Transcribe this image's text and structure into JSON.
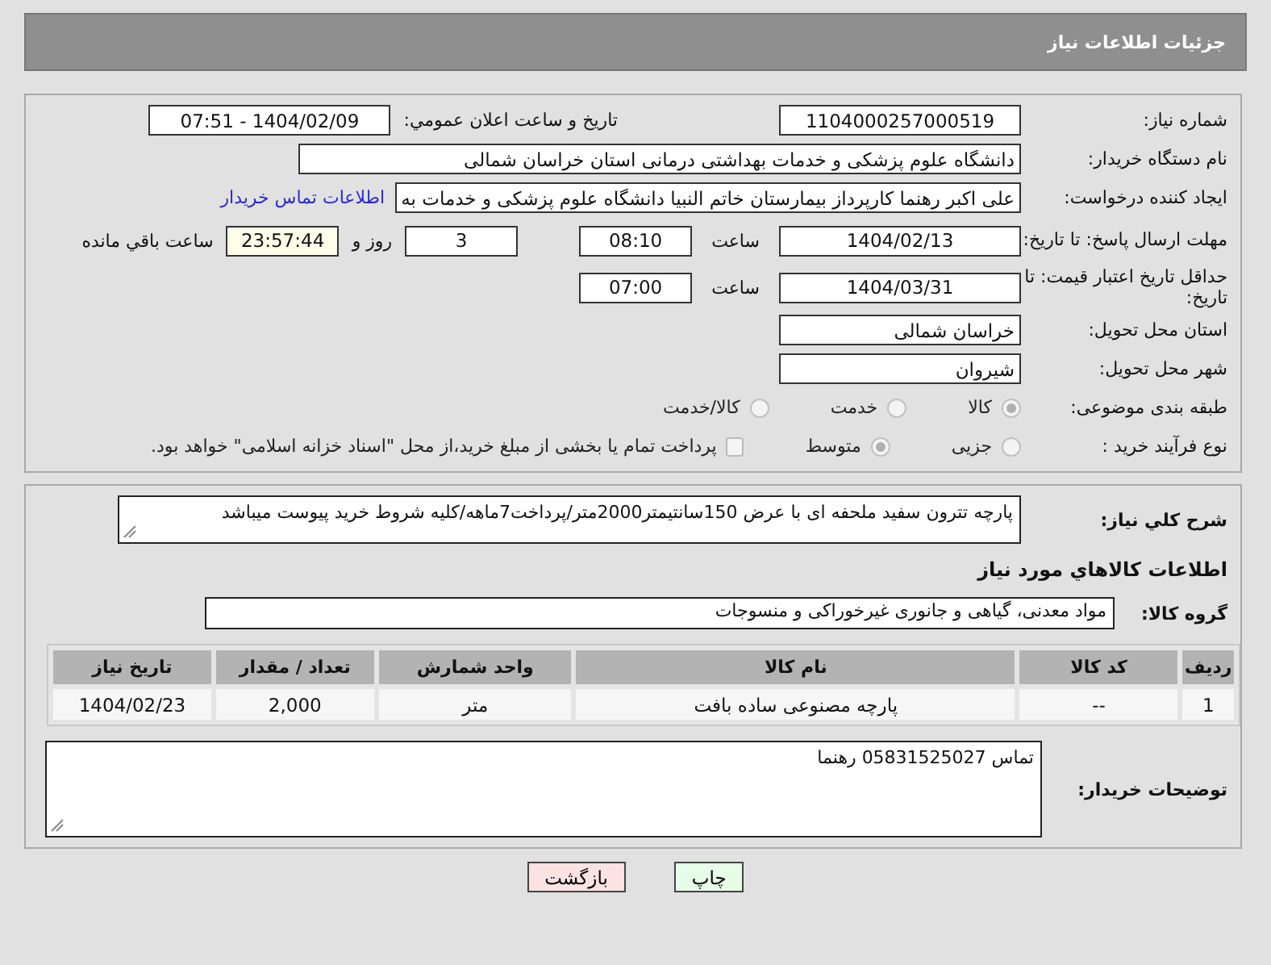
{
  "header": {
    "title": "جزئیات اطلاعات نیاز"
  },
  "need_number": {
    "label": "شماره نیاز:",
    "value": "1104000257000519"
  },
  "announce": {
    "label": "تاریخ و ساعت اعلان عمومي:",
    "value": "1404/02/09 - 07:51"
  },
  "buyer": {
    "label": "نام دستگاه خریدار:",
    "value": "دانشگاه علوم پزشکی و خدمات بهداشتی درمانی استان خراسان شمالی"
  },
  "requester": {
    "label": "ایجاد کننده درخواست:",
    "value": "علی اکبر رهنما کارپرداز بیمارستان خاتم النبیا دانشگاه علوم پزشکی و خدمات به",
    "link": "اطلاعات تماس خریدار"
  },
  "deadline": {
    "label": "مهلت ارسال پاسخ: تا تاریخ:",
    "date": "1404/02/13",
    "time_label": "ساعت",
    "time": "08:10",
    "days": "3",
    "days_label": "روز و",
    "remaining": "23:57:44",
    "remaining_label": "ساعت باقي مانده"
  },
  "validity": {
    "label": "حداقل تاریخ اعتبار قیمت: تا تاریخ:",
    "date": "1404/03/31",
    "time_label": "ساعت",
    "time": "07:00"
  },
  "province": {
    "label": "استان محل تحویل:",
    "value": "خراسان شمالی"
  },
  "city": {
    "label": "شهر محل تحویل:",
    "value": "شیروان"
  },
  "category": {
    "label": "طبقه بندی موضوعی:",
    "options": [
      {
        "label": "کالا",
        "selected": true
      },
      {
        "label": "خدمت",
        "selected": false
      },
      {
        "label": "کالا/خدمت",
        "selected": false
      }
    ]
  },
  "process": {
    "label": "نوع فرآیند خرید :",
    "options": [
      {
        "label": "جزیی",
        "selected": false
      },
      {
        "label": "متوسط",
        "selected": true
      }
    ],
    "treasury": {
      "label": "پرداخت تمام یا بخشی از مبلغ خرید،از محل \"اسناد خزانه اسلامی\" خواهد بود.",
      "checked": false
    }
  },
  "description": {
    "label": "شرح کلي نياز:",
    "value": "پارچه تترون سفید ملحفه ای با عرض 150سانتیمتر2000متر/پرداخت7ماهه/کلیه شروط خرید پیوست میباشد"
  },
  "goods_heading": "اطلاعات کالاهاي مورد نياز",
  "goods_group": {
    "label": "گروه کالا:",
    "value": "مواد معدنی، گیاهی و جانوری غیرخوراکی و منسوجات"
  },
  "table": {
    "columns": [
      "ردیف",
      "کد کالا",
      "نام کالا",
      "واحد شمارش",
      "تعداد / مقدار",
      "تاریخ نیاز"
    ],
    "rows": [
      [
        "1",
        "--",
        "پارچه مصنوعی ساده بافت",
        "متر",
        "2,000",
        "1404/02/23"
      ]
    ]
  },
  "buyer_notes": {
    "label": "توضیحات خریدار:",
    "value": "تماس 05831525027 رهنما"
  },
  "buttons": [
    {
      "label": "چاپ",
      "kind": "print"
    },
    {
      "label": "بازگشت",
      "kind": "back"
    }
  ]
}
